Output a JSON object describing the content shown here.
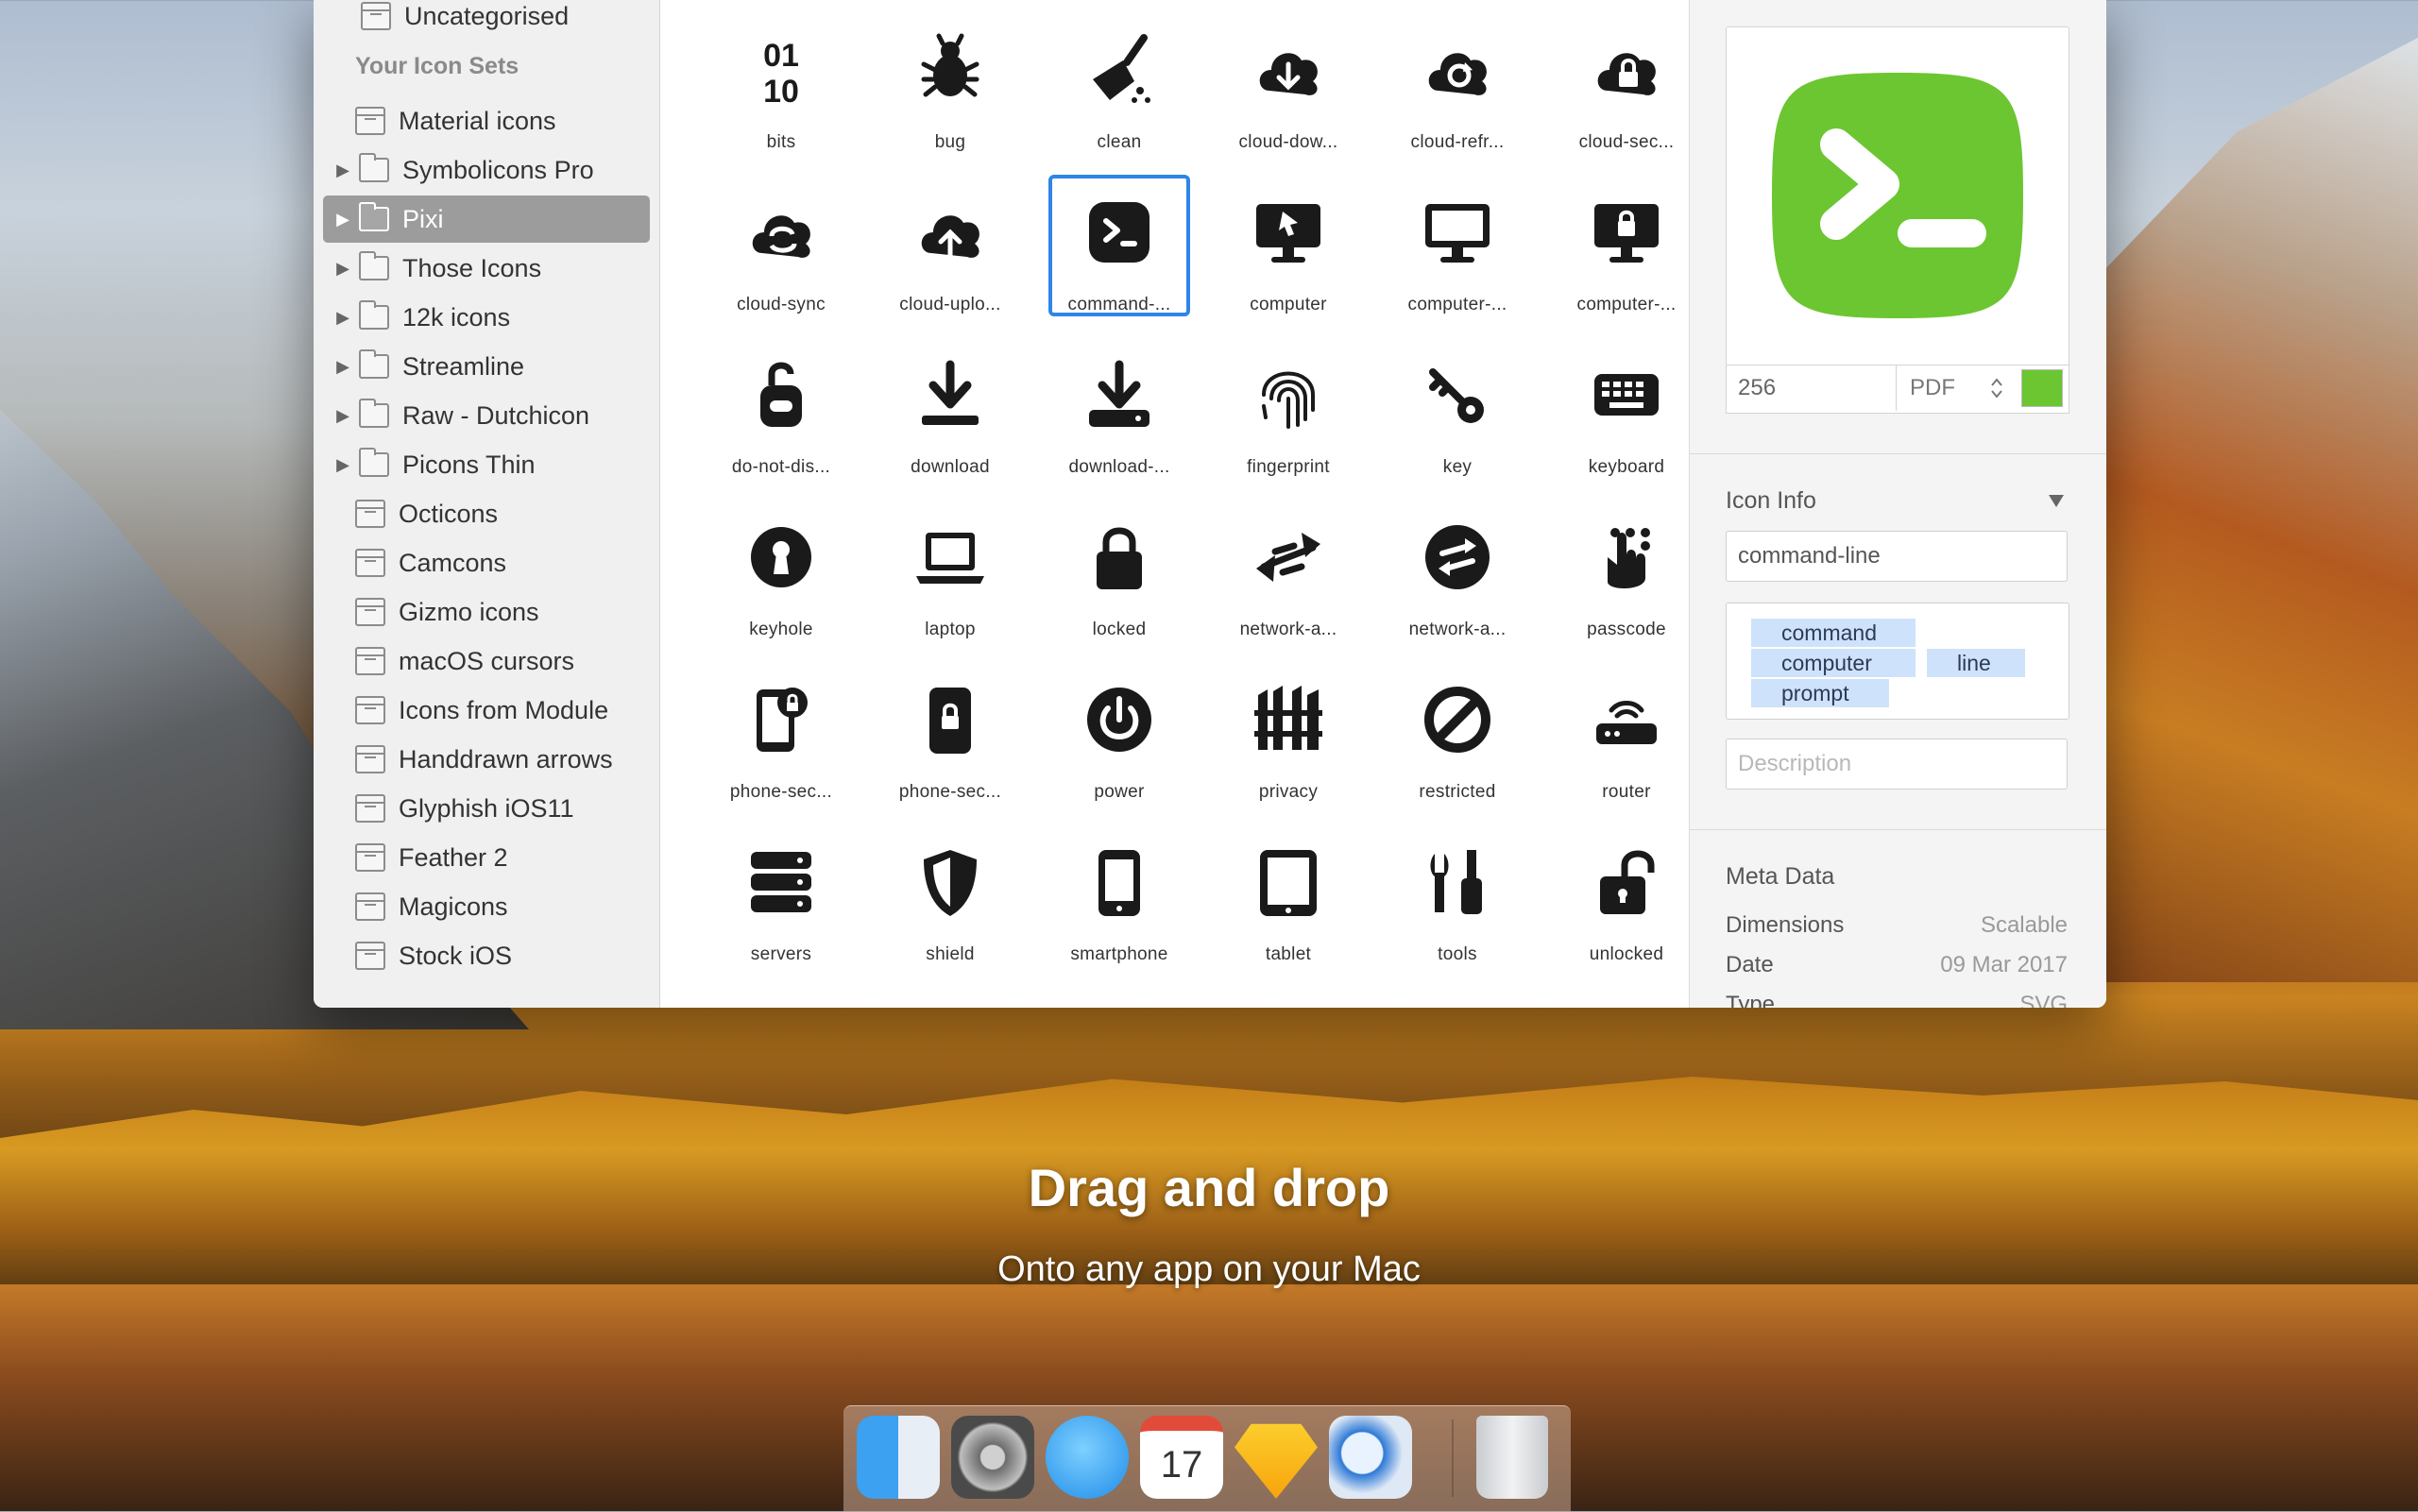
{
  "hero": {
    "title": "Drag and drop",
    "subtitle": "Onto any app on your Mac"
  },
  "sidebar": {
    "top_item": "Uncategorised",
    "section": "Your Icon Sets",
    "items": [
      {
        "label": "Material icons",
        "type": "set",
        "expandable": false
      },
      {
        "label": "Symbolicons Pro",
        "type": "folder",
        "expandable": true
      },
      {
        "label": "Pixi",
        "type": "folder",
        "expandable": true,
        "selected": true
      },
      {
        "label": "Those Icons",
        "type": "folder",
        "expandable": true
      },
      {
        "label": "12k icons",
        "type": "folder",
        "expandable": true
      },
      {
        "label": "Streamline",
        "type": "folder",
        "expandable": true
      },
      {
        "label": "Raw - Dutchicon",
        "type": "folder",
        "expandable": true
      },
      {
        "label": "Picons Thin",
        "type": "folder",
        "expandable": true
      },
      {
        "label": "Octicons",
        "type": "set",
        "expandable": false
      },
      {
        "label": "Camcons",
        "type": "set",
        "expandable": false
      },
      {
        "label": "Gizmo icons",
        "type": "set",
        "expandable": false
      },
      {
        "label": "macOS cursors",
        "type": "set",
        "expandable": false
      },
      {
        "label": "Icons from Module",
        "type": "set",
        "expandable": false
      },
      {
        "label": "Handdrawn arrows",
        "type": "set",
        "expandable": false
      },
      {
        "label": "Glyphish iOS11",
        "type": "set",
        "expandable": false
      },
      {
        "label": "Feather 2",
        "type": "set",
        "expandable": false
      },
      {
        "label": "Magicons",
        "type": "set",
        "expandable": false
      },
      {
        "label": "Stock iOS",
        "type": "set",
        "expandable": false
      }
    ]
  },
  "icons": [
    {
      "label": "bits",
      "icon": "bits-icon"
    },
    {
      "label": "bug",
      "icon": "bug-icon"
    },
    {
      "label": "clean",
      "icon": "clean-icon"
    },
    {
      "label": "cloud-dow...",
      "icon": "cloud-download-icon"
    },
    {
      "label": "cloud-refr...",
      "icon": "cloud-refresh-icon"
    },
    {
      "label": "cloud-sec...",
      "icon": "cloud-secure-icon"
    },
    {
      "label": "cloud-sync",
      "icon": "cloud-sync-icon"
    },
    {
      "label": "cloud-uplo...",
      "icon": "cloud-upload-icon"
    },
    {
      "label": "command-...",
      "icon": "command-line-icon",
      "selected": true
    },
    {
      "label": "computer",
      "icon": "computer-icon"
    },
    {
      "label": "computer-...",
      "icon": "computer-blank-icon"
    },
    {
      "label": "computer-...",
      "icon": "computer-lock-icon"
    },
    {
      "label": "do-not-dis...",
      "icon": "do-not-disturb-icon"
    },
    {
      "label": "download",
      "icon": "download-icon"
    },
    {
      "label": "download-...",
      "icon": "download-drive-icon"
    },
    {
      "label": "fingerprint",
      "icon": "fingerprint-icon"
    },
    {
      "label": "key",
      "icon": "key-icon"
    },
    {
      "label": "keyboard",
      "icon": "keyboard-icon"
    },
    {
      "label": "keyhole",
      "icon": "keyhole-icon"
    },
    {
      "label": "laptop",
      "icon": "laptop-icon"
    },
    {
      "label": "locked",
      "icon": "locked-icon"
    },
    {
      "label": "network-a...",
      "icon": "network-arrows-icon"
    },
    {
      "label": "network-a...",
      "icon": "network-arrows-circle-icon"
    },
    {
      "label": "passcode",
      "icon": "passcode-icon"
    },
    {
      "label": "phone-sec...",
      "icon": "phone-secure-icon"
    },
    {
      "label": "phone-sec...",
      "icon": "phone-secure-lock-icon"
    },
    {
      "label": "power",
      "icon": "power-icon"
    },
    {
      "label": "privacy",
      "icon": "privacy-icon"
    },
    {
      "label": "restricted",
      "icon": "restricted-icon"
    },
    {
      "label": "router",
      "icon": "router-icon"
    },
    {
      "label": "servers",
      "icon": "servers-icon"
    },
    {
      "label": "shield",
      "icon": "shield-icon"
    },
    {
      "label": "smartphone",
      "icon": "smartphone-icon"
    },
    {
      "label": "tablet",
      "icon": "tablet-icon"
    },
    {
      "label": "tools",
      "icon": "tools-icon"
    },
    {
      "label": "unlocked",
      "icon": "unlocked-icon"
    }
  ],
  "inspector": {
    "preview_color": "#6cc631",
    "size_value": "256",
    "format": "PDF",
    "swatch_color": "#6cc631",
    "icon_info_title": "Icon Info",
    "name_value": "command-line",
    "tags": [
      "command",
      "computer",
      "line",
      "prompt"
    ],
    "description_placeholder": "Description",
    "meta_title": "Meta Data",
    "meta": [
      {
        "key": "Dimensions",
        "value": "Scalable"
      },
      {
        "key": "Date",
        "value": "09 Mar 2017"
      },
      {
        "key": "Type",
        "value": "SVG"
      }
    ]
  },
  "dock": {
    "apps": [
      "Finder",
      "System Preferences",
      "Messages",
      "Calendar",
      "Sketch",
      "Iconjar",
      "Trash"
    ],
    "calendar_day": "17"
  }
}
